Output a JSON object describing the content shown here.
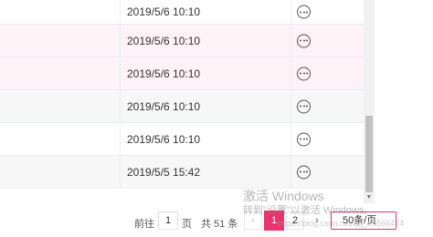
{
  "rows": [
    {
      "time": "2019/5/6 10:10",
      "bg": "white"
    },
    {
      "time": "2019/5/6 10:10",
      "bg": "pink"
    },
    {
      "time": "2019/5/6 10:10",
      "bg": "pink"
    },
    {
      "time": "2019/5/6 10:10",
      "bg": "gray"
    },
    {
      "time": "2019/5/6 10:10",
      "bg": "white"
    },
    {
      "time": "2019/5/5 15:42",
      "bg": "gray"
    }
  ],
  "pagination": {
    "goto_label": "前往",
    "goto_value": "1",
    "page_suffix": "页",
    "total_label": "共 51 条",
    "prev_icon": "chevron-left",
    "page1": "1",
    "page2": "2",
    "next_icon": "chevron-right",
    "page_size": "50条/页"
  },
  "watermark": {
    "line1": "激活 Windows",
    "line2": "转到\"设置\"以激活 Windows。",
    "line3": "https://blog.csdn.net/qq_35566474"
  },
  "colors": {
    "accent": "#e8336d",
    "row_pink": "#fdf2f5",
    "row_gray": "#f7f7f7"
  }
}
